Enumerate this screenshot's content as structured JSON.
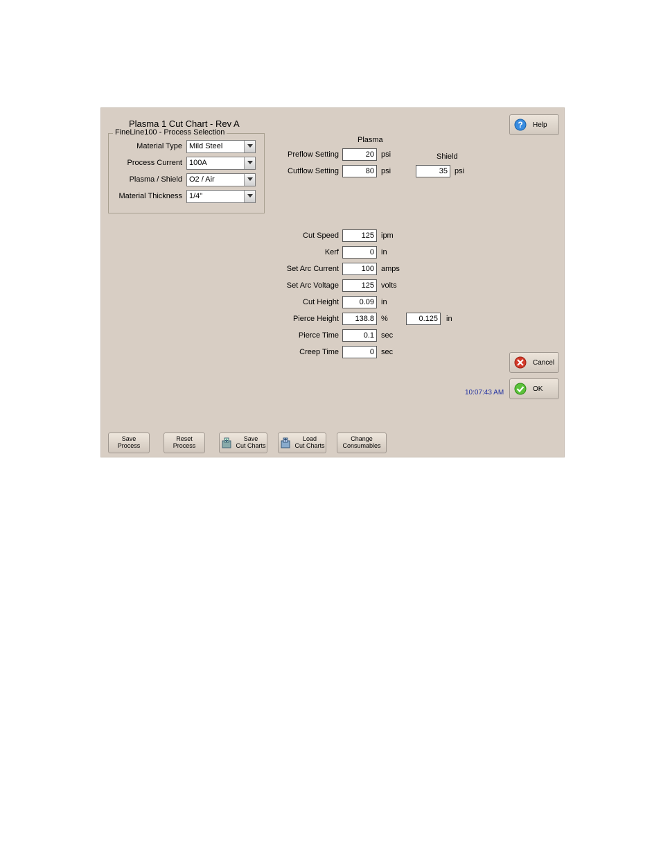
{
  "title": "Plasma 1 Cut Chart - Rev A",
  "group": {
    "legend": "FineLine100 - Process Selection",
    "material_type": {
      "label": "Material Type",
      "value": "Mild Steel"
    },
    "process_current": {
      "label": "Process Current",
      "value": "100A"
    },
    "plasma_shield": {
      "label": "Plasma / Shield",
      "value": "O2 / Air"
    },
    "material_thickness": {
      "label": "Material Thickness",
      "value": "1/4\""
    }
  },
  "plasma": {
    "heading": "Plasma",
    "preflow": {
      "label": "Preflow Setting",
      "value": "20",
      "unit": "psi"
    },
    "cutflow": {
      "label": "Cutflow Setting",
      "value": "80",
      "unit": "psi"
    }
  },
  "shield": {
    "heading": "Shield",
    "value": "35",
    "unit": "psi"
  },
  "params": {
    "cut_speed": {
      "label": "Cut Speed",
      "value": "125",
      "unit": "ipm"
    },
    "kerf": {
      "label": "Kerf",
      "value": "0",
      "unit": "in"
    },
    "arc_current": {
      "label": "Set Arc Current",
      "value": "100",
      "unit": "amps"
    },
    "arc_voltage": {
      "label": "Set Arc Voltage",
      "value": "125",
      "unit": "volts"
    },
    "cut_height": {
      "label": "Cut Height",
      "value": "0.09",
      "unit": "in"
    },
    "pierce_height": {
      "label": "Pierce Height",
      "value": "138.8",
      "unit": "%",
      "value2": "0.125",
      "unit2": "in"
    },
    "pierce_time": {
      "label": "Pierce Time",
      "value": "0.1",
      "unit": "sec"
    },
    "creep_time": {
      "label": "Creep Time",
      "value": "0",
      "unit": "sec"
    }
  },
  "timestamp": "10:07:43 AM",
  "buttons": {
    "save_process": "Save\nProcess",
    "reset_process": "Reset\nProcess",
    "save_cut_charts": "Save\nCut Charts",
    "load_cut_charts": "Load\nCut Charts",
    "change_consumables": "Change\nConsumables"
  },
  "right": {
    "help": "Help",
    "cancel": "Cancel",
    "ok": "OK"
  }
}
